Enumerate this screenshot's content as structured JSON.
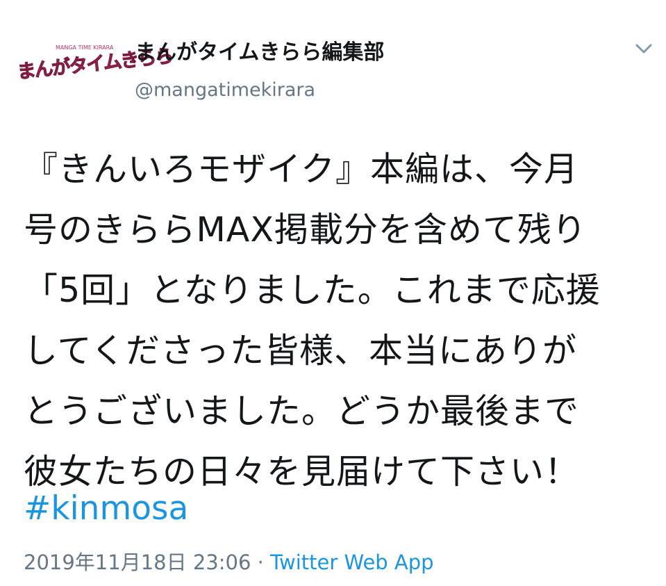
{
  "author": {
    "avatar_logo_text": "まんがタイムきらら",
    "avatar_logo_small": "MANGA TIME KIRARA",
    "display_name": "まんがタイムきらら編集部",
    "handle": "@mangatimekirara"
  },
  "menu": {
    "icon": "chevron-down-icon"
  },
  "tweet": {
    "lines": [
      "『きんいろモザイク』本編は、今月",
      "号のきららMAX掲載分を含めて残り",
      "「5回」となりました。これまで応援",
      "してくださった皆様、本当にありが",
      "とうございました。どうか最後まで",
      "彼女たちの日々を見届けて下さい！"
    ],
    "hashtag": "#kinmosa"
  },
  "meta": {
    "timestamp": "2019年11月18日 23:06",
    "separator": " · ",
    "source": "Twitter Web App"
  },
  "colors": {
    "link": "#1b95e0",
    "secondary_text": "#657786",
    "primary_text": "#14171a",
    "logo_pink": "#e8457f"
  }
}
